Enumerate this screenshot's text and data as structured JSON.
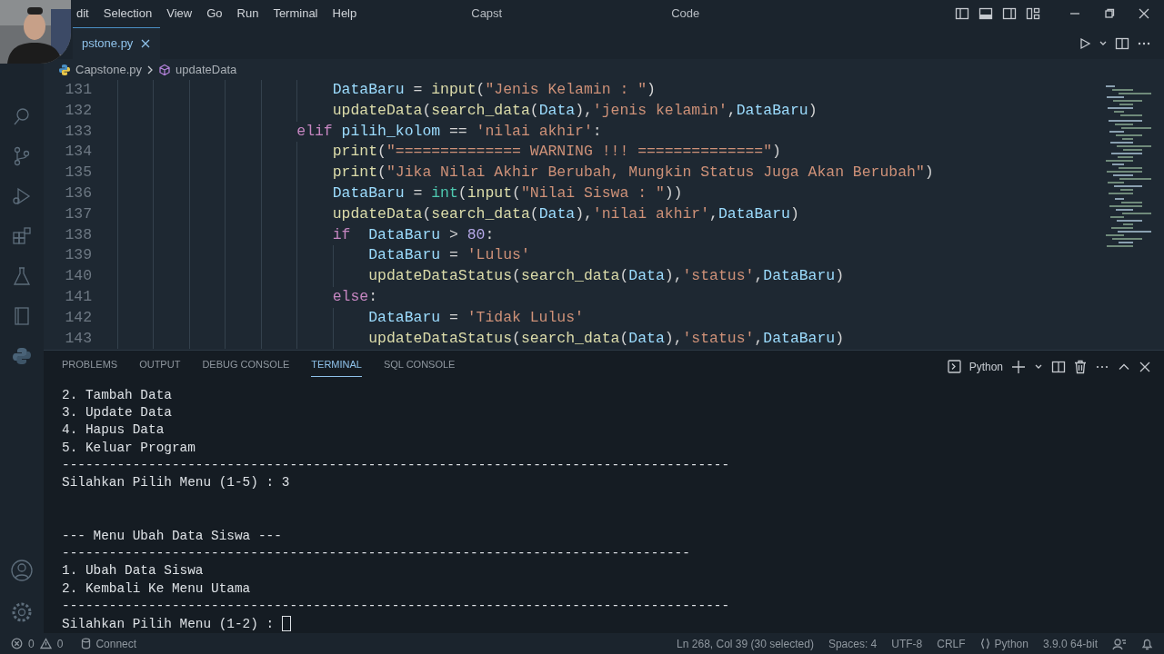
{
  "title_bar": {
    "menu": [
      "dit",
      "Selection",
      "View",
      "Go",
      "Run",
      "Terminal",
      "Help"
    ],
    "title_start": "Capst",
    "title_end": "Code"
  },
  "webcam": {
    "kind": "picture"
  },
  "editor_tabs": [
    {
      "label": "pstone.py",
      "selected": true
    }
  ],
  "breadcrumb": [
    "Capstone.py",
    "updateData"
  ],
  "code_lines": [
    {
      "number": "131",
      "tokens": [
        {
          "text": "                        DataBaru",
          "kind": "v"
        },
        {
          "text": " = ",
          "kind": "p"
        },
        {
          "text": "input",
          "kind": "f"
        },
        {
          "text": "(",
          "kind": "p"
        },
        {
          "text": "\"Jenis Kelamin : \"",
          "kind": "s"
        },
        {
          "text": ")",
          "kind": "p"
        }
      ]
    },
    {
      "number": "132",
      "tokens": [
        {
          "text": "                        updateData",
          "kind": "f"
        },
        {
          "text": "(",
          "kind": "p"
        },
        {
          "text": "search_data",
          "kind": "f"
        },
        {
          "text": "(",
          "kind": "p"
        },
        {
          "text": "Data",
          "kind": "v"
        },
        {
          "text": "),",
          "kind": "p"
        },
        {
          "text": "'jenis kelamin'",
          "kind": "s"
        },
        {
          "text": ",",
          "kind": "p"
        },
        {
          "text": "DataBaru",
          "kind": "v"
        },
        {
          "text": ")",
          "kind": "p"
        }
      ]
    },
    {
      "number": "133",
      "tokens": [
        {
          "text": "                    elif",
          "kind": "k"
        },
        {
          "text": " pilih_kolom",
          "kind": "v"
        },
        {
          "text": " == ",
          "kind": "p"
        },
        {
          "text": "'nilai akhir'",
          "kind": "s"
        },
        {
          "text": ":",
          "kind": "p"
        }
      ]
    },
    {
      "number": "134",
      "tokens": [
        {
          "text": "                        print",
          "kind": "f"
        },
        {
          "text": "(",
          "kind": "p"
        },
        {
          "text": "\"============== WARNING !!! ==============\"",
          "kind": "s"
        },
        {
          "text": ")",
          "kind": "p"
        }
      ]
    },
    {
      "number": "135",
      "tokens": [
        {
          "text": "                        print",
          "kind": "f"
        },
        {
          "text": "(",
          "kind": "p"
        },
        {
          "text": "\"Jika Nilai Akhir Berubah, Mungkin Status Juga Akan Berubah\"",
          "kind": "s"
        },
        {
          "text": ")",
          "kind": "p"
        }
      ]
    },
    {
      "number": "136",
      "tokens": [
        {
          "text": "                        DataBaru",
          "kind": "v"
        },
        {
          "text": " = ",
          "kind": "p"
        },
        {
          "text": "int",
          "kind": "c"
        },
        {
          "text": "(",
          "kind": "p"
        },
        {
          "text": "input",
          "kind": "f"
        },
        {
          "text": "(",
          "kind": "p"
        },
        {
          "text": "\"Nilai Siswa : \"",
          "kind": "s"
        },
        {
          "text": "))",
          "kind": "p"
        }
      ]
    },
    {
      "number": "137",
      "tokens": [
        {
          "text": "                        updateData",
          "kind": "f"
        },
        {
          "text": "(",
          "kind": "p"
        },
        {
          "text": "search_data",
          "kind": "f"
        },
        {
          "text": "(",
          "kind": "p"
        },
        {
          "text": "Data",
          "kind": "v"
        },
        {
          "text": "),",
          "kind": "p"
        },
        {
          "text": "'nilai akhir'",
          "kind": "s"
        },
        {
          "text": ",",
          "kind": "p"
        },
        {
          "text": "DataBaru",
          "kind": "v"
        },
        {
          "text": ")",
          "kind": "p"
        }
      ]
    },
    {
      "number": "138",
      "tokens": [
        {
          "text": "                        if",
          "kind": "k"
        },
        {
          "text": "  DataBaru",
          "kind": "v"
        },
        {
          "text": " > ",
          "kind": "p"
        },
        {
          "text": "80",
          "kind": "n"
        },
        {
          "text": ":",
          "kind": "p"
        }
      ]
    },
    {
      "number": "139",
      "tokens": [
        {
          "text": "                            DataBaru",
          "kind": "v"
        },
        {
          "text": " = ",
          "kind": "p"
        },
        {
          "text": "'Lulus'",
          "kind": "s"
        }
      ]
    },
    {
      "number": "140",
      "tokens": [
        {
          "text": "                            updateDataStatus",
          "kind": "f"
        },
        {
          "text": "(",
          "kind": "p"
        },
        {
          "text": "search_data",
          "kind": "f"
        },
        {
          "text": "(",
          "kind": "p"
        },
        {
          "text": "Data",
          "kind": "v"
        },
        {
          "text": "),",
          "kind": "p"
        },
        {
          "text": "'status'",
          "kind": "s"
        },
        {
          "text": ",",
          "kind": "p"
        },
        {
          "text": "DataBaru",
          "kind": "v"
        },
        {
          "text": ")",
          "kind": "p"
        }
      ]
    },
    {
      "number": "141",
      "tokens": [
        {
          "text": "                        else",
          "kind": "k"
        },
        {
          "text": ":",
          "kind": "p"
        }
      ]
    },
    {
      "number": "142",
      "tokens": [
        {
          "text": "                            DataBaru",
          "kind": "v"
        },
        {
          "text": " = ",
          "kind": "p"
        },
        {
          "text": "'Tidak Lulus'",
          "kind": "s"
        }
      ]
    },
    {
      "number": "143",
      "tokens": [
        {
          "text": "                            updateDataStatus",
          "kind": "f"
        },
        {
          "text": "(",
          "kind": "p"
        },
        {
          "text": "search_data",
          "kind": "f"
        },
        {
          "text": "(",
          "kind": "p"
        },
        {
          "text": "Data",
          "kind": "v"
        },
        {
          "text": "),",
          "kind": "p"
        },
        {
          "text": "'status'",
          "kind": "s"
        },
        {
          "text": ",",
          "kind": "p"
        },
        {
          "text": "DataBaru",
          "kind": "v"
        },
        {
          "text": ")",
          "kind": "p"
        }
      ]
    }
  ],
  "panel_tabs": [
    {
      "label": "PROBLEMS",
      "selected": false
    },
    {
      "label": "OUTPUT",
      "selected": false
    },
    {
      "label": "DEBUG CONSOLE",
      "selected": false
    },
    {
      "label": "TERMINAL",
      "selected": true
    },
    {
      "label": "SQL CONSOLE",
      "selected": false
    }
  ],
  "terminal_profile": "Python",
  "terminal_blocks": [
    [
      "2. Tambah Data",
      "3. Update Data",
      "4. Hapus Data",
      "5. Keluar Program",
      "-------------------------------------------------------------------------------------",
      "Silahkan Pilih Menu (1-5) : 3"
    ],
    [
      "--- Menu Ubah Data Siswa ---",
      "--------------------------------------------------------------------------------",
      "1. Ubah Data Siswa",
      "2. Kembali Ke Menu Utama",
      "-------------------------------------------------------------------------------------",
      "Silahkan Pilih Menu (1-2) :"
    ]
  ],
  "status_bar": {
    "errors": "0",
    "warnings": "0",
    "connect": "Connect",
    "right": [
      "Ln 268, Col 39 (30 selected)",
      "Spaces: 4",
      "UTF-8",
      "CRLF"
    ],
    "language": "Python",
    "interpreter": "3.9.0 64-bit"
  }
}
